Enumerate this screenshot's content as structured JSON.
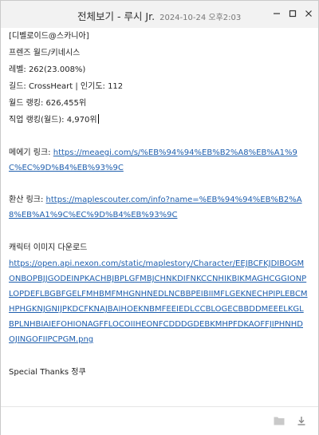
{
  "window": {
    "title": "전체보기 - 루시 Jr.",
    "timestamp": "2024-10-24 오후2:03",
    "controls": [
      "minimize-icon",
      "maximize-icon",
      "close-icon"
    ]
  },
  "message": {
    "lines": [
      "[디벨로이드@스카니아]",
      "프렌즈 월드/키네시스",
      "레벨: 262(23.008%)",
      "길드: CrossHeart  |  인기도: 112",
      "월드 랭킹: 626,455위",
      "직업 랭킹(월드): 4,970위"
    ],
    "meaegi": {
      "label": "메에기 링크:",
      "url": "https://meaegi.com/s/%EB%94%94%EB%B2%A8%EB%A1%9C%EC%9D%B4%EB%93%9C"
    },
    "maple_scouter": {
      "label": "환산 링크:",
      "url": "https://maplescouter.com/info?name=%EB%94%94%EB%B2%A8%EB%A1%9C%EC%9D%B4%EB%93%9C"
    },
    "character_image": {
      "label": "캐릭터 이미지 다운로드",
      "url": "https://open.api.nexon.com/static/maplestory/Character/EEJBCFKJDIBOGMONBOPBJJGODEINPKACHBJBPLGFMBJCHNKDIFNKCCNHIKBIKMAGHCGGIONPLOPDEFLBGBFGELFMHBMFMHGNHNEDLNCBBPEIBIIMFLGEKNECHPIPLEBCMHPHGKNJGNIJPKDCFKNAJBAIHOEKNBMFEEIEDLCCBLOGECBBDDMEEELKGLBPLNHBIAIEFOHIONAGFFLOCOIIHEONFCDDDGDEBKMHPFDKAOFFJIPHNHDOJINGOFIIPCPGM.png"
    },
    "thanks": "Special Thanks 정쿠"
  },
  "bottom_bar": {
    "icons": [
      "folder-icon",
      "download-icon"
    ]
  }
}
